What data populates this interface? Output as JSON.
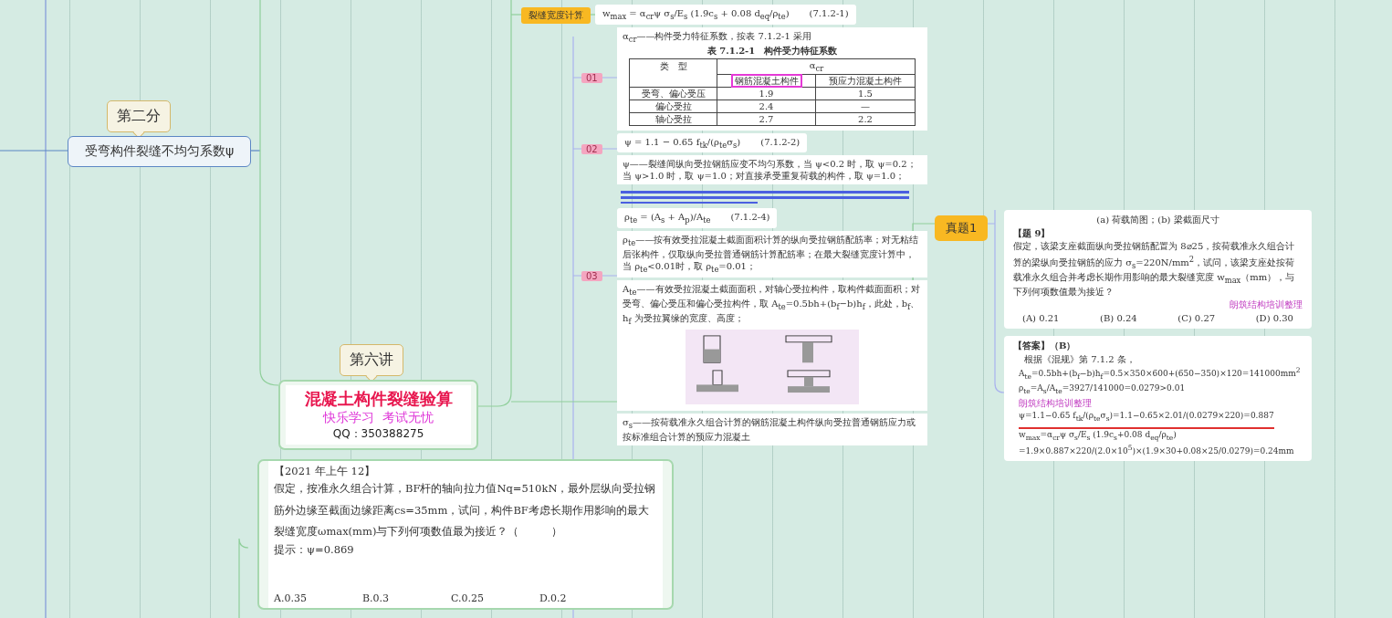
{
  "left_branch": {
    "callout": "第二分",
    "topic": "受弯构件裂缝不均匀系数ψ"
  },
  "central": {
    "callout": "第六讲",
    "title": "混凝土构件裂缝验算",
    "subtitle": "快乐学习  考试无忧",
    "qq": "QQ：350388275"
  },
  "crack_width": {
    "label": "裂缝宽度计算",
    "formula": {
      "expr": "w$_{max}$ = α$_{cr}$ψ σ$_{s}$/E$_{s}$ (1.9c$_{s}$ + 0.08 d$_{eq}$/ρ$_{te}$)",
      "number": "(7.1.2-1)"
    },
    "tags": [
      "01",
      "02",
      "03"
    ],
    "cards": [
      {
        "kind": "table",
        "note": "α$_{cr}$——构件受力特征系数，按表 7.1.2-1 采用",
        "caption": "表 7.1.2-1　构件受力特征系数",
        "type_head": "类　型",
        "coef_head": "α$_{cr}$",
        "columns": [
          {},
          {
            "label": "钢筋混凝土构件",
            "highlighted": true
          },
          {
            "label": "预应力混凝土构件",
            "highlighted": false
          }
        ],
        "rows": [
          [
            "受弯、偏心受压",
            "1.9",
            "1.5"
          ],
          [
            "偏心受拉",
            "2.4",
            "—"
          ],
          [
            "轴心受拉",
            "2.7",
            "2.2"
          ]
        ]
      },
      {
        "kind": "formula",
        "expr": "ψ = 1.1 − 0.65 f$_{tk}$/(ρ$_{te}$σ$_{s}$)",
        "number": "(7.1.2-2)"
      },
      {
        "kind": "text",
        "text": "ψ——裂缝间纵向受拉钢筋应变不均匀系数，当 ψ<0.2 时，取 ψ=0.2；当 ψ>1.0 时，取 ψ=1.0；对直接承受重复荷载的构件，取 ψ=1.0；"
      },
      {
        "kind": "blurred"
      },
      {
        "kind": "formula",
        "expr": "ρ$_{te}$ = (A$_{s}$ + A$_{p}$)/A$_{te}$",
        "number": "(7.1.2-4)"
      },
      {
        "kind": "text",
        "text": "ρ$_{te}$——按有效受拉混凝土截面面积计算的纵向受拉钢筋配筋率；对无粘结后张构件，仅取纵向受拉普通钢筋计算配筋率；在最大裂缝宽度计算中，当 ρ$_{te}$<0.01时，取 ρ$_{te}$=0.01；"
      },
      {
        "kind": "figure",
        "text": "A$_{te}$——有效受拉混凝土截面面积，对轴心受拉构件，取构件截面面积；对受弯、偏心受压和偏心受拉构件，取 A$_{te}$=0.5bh+(b$_{f}$−b)h$_{f}$，此处，b$_{f}$、h$_{f}$ 为受拉翼缘的宽度、高度；"
      },
      {
        "kind": "text",
        "text": "σ$_{s}$——按荷载准永久组合计算的钢筋混凝土构件纵向受拉普通钢筋应力或按标准组合计算的预应力混凝土"
      }
    ]
  },
  "exam": {
    "label": "真题1",
    "caption": "(a) 荷载简图；(b) 梁截面尺寸",
    "heading": "【题 9】",
    "question": "假定，该梁支座截面纵向受拉钢筋配置为 8⌀25，按荷载准永久组合计算的梁纵向受拉钢筋的应力 σ$_{s}$=220N/mm$^{2}$，试问，该梁支座处按荷载准永久组合并考虑长期作用影响的最大裂缝宽度 w$_{max}$（mm），与下列何项数值最为接近？",
    "stamp": "朗筑结构培训整理",
    "options": [
      "(A) 0.21",
      "(B) 0.24",
      "(C) 0.27",
      "(D) 0.30"
    ],
    "answer_heading": "【答案】（B）",
    "answer_intro": "根据《混规》第 7.1.2 条，",
    "steps": [
      {
        "kind": "plain",
        "text": "A$_{te}$=0.5bh+(b$_{f}$−b)h$_{f}$=0.5×350×600+(650−350)×120=141000mm$^{2}$"
      },
      {
        "kind": "plain",
        "text": "ρ$_{te}$=A$_{s}$/A$_{te}$=3927/141000=0.0279>0.01"
      },
      {
        "kind": "stamp",
        "text": "朗筑结构培训整理"
      },
      {
        "kind": "underlined",
        "text": "ψ=1.1−0.65 f$_{tk}$/(ρ$_{te}$σ$_{s}$)=1.1−0.65×2.01/(0.0279×220)=0.887"
      },
      {
        "kind": "plain",
        "text": "w$_{max}$=α$_{cr}$ψ σ$_{s}$/E$_{s}$ (1.9c$_{s}$+0.08 d$_{eq}$/ρ$_{te}$)"
      },
      {
        "kind": "plain",
        "text": "=1.9×0.887×220/(2.0×10$^{5}$)×(1.9×30+0.08×25/0.0279)=0.24mm"
      }
    ]
  },
  "practice": {
    "heading": "【2021 年上午 12】",
    "question": "假定，按准永久组合计算，BF杆的轴向拉力值Nq=510kN，最外层纵向受拉钢筋外边缘至截面边缘距离cs=35mm，试问，构件BF考虑长期作用影响的最大裂缝宽度ωmax(mm)与下列何项数值最为接近？（　　　）",
    "hint": "提示：ψ=0.869",
    "options": [
      "A.0.35",
      "B.0.3",
      "C.0.25",
      "D.0.2"
    ]
  }
}
